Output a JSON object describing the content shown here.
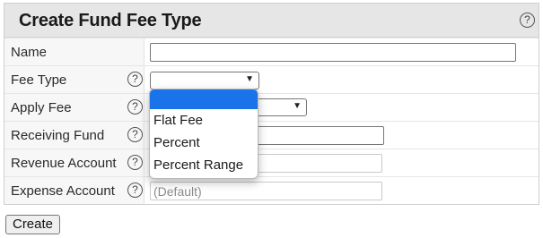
{
  "form": {
    "title": "Create Fund Fee Type",
    "help_glyph": "?",
    "rows": [
      {
        "label": "Name"
      },
      {
        "label": "Fee Type"
      },
      {
        "label": "Apply Fee"
      },
      {
        "label": "Receiving Fund"
      },
      {
        "label": "Revenue Account"
      },
      {
        "label": "Expense Account",
        "placeholder": "(Default)"
      }
    ]
  },
  "fee_type_dropdown": {
    "selected_value": "",
    "options": [
      "",
      "Flat Fee",
      "Percent",
      "Percent Range"
    ]
  },
  "buttons": {
    "create_label": "Create"
  },
  "colors": {
    "header_bg": "#e6e6e6",
    "label_bg": "#f7f7f7",
    "dropdown_highlight": "#1a73e8"
  },
  "icons": [
    "help-icon",
    "chevron-down-icon"
  ]
}
